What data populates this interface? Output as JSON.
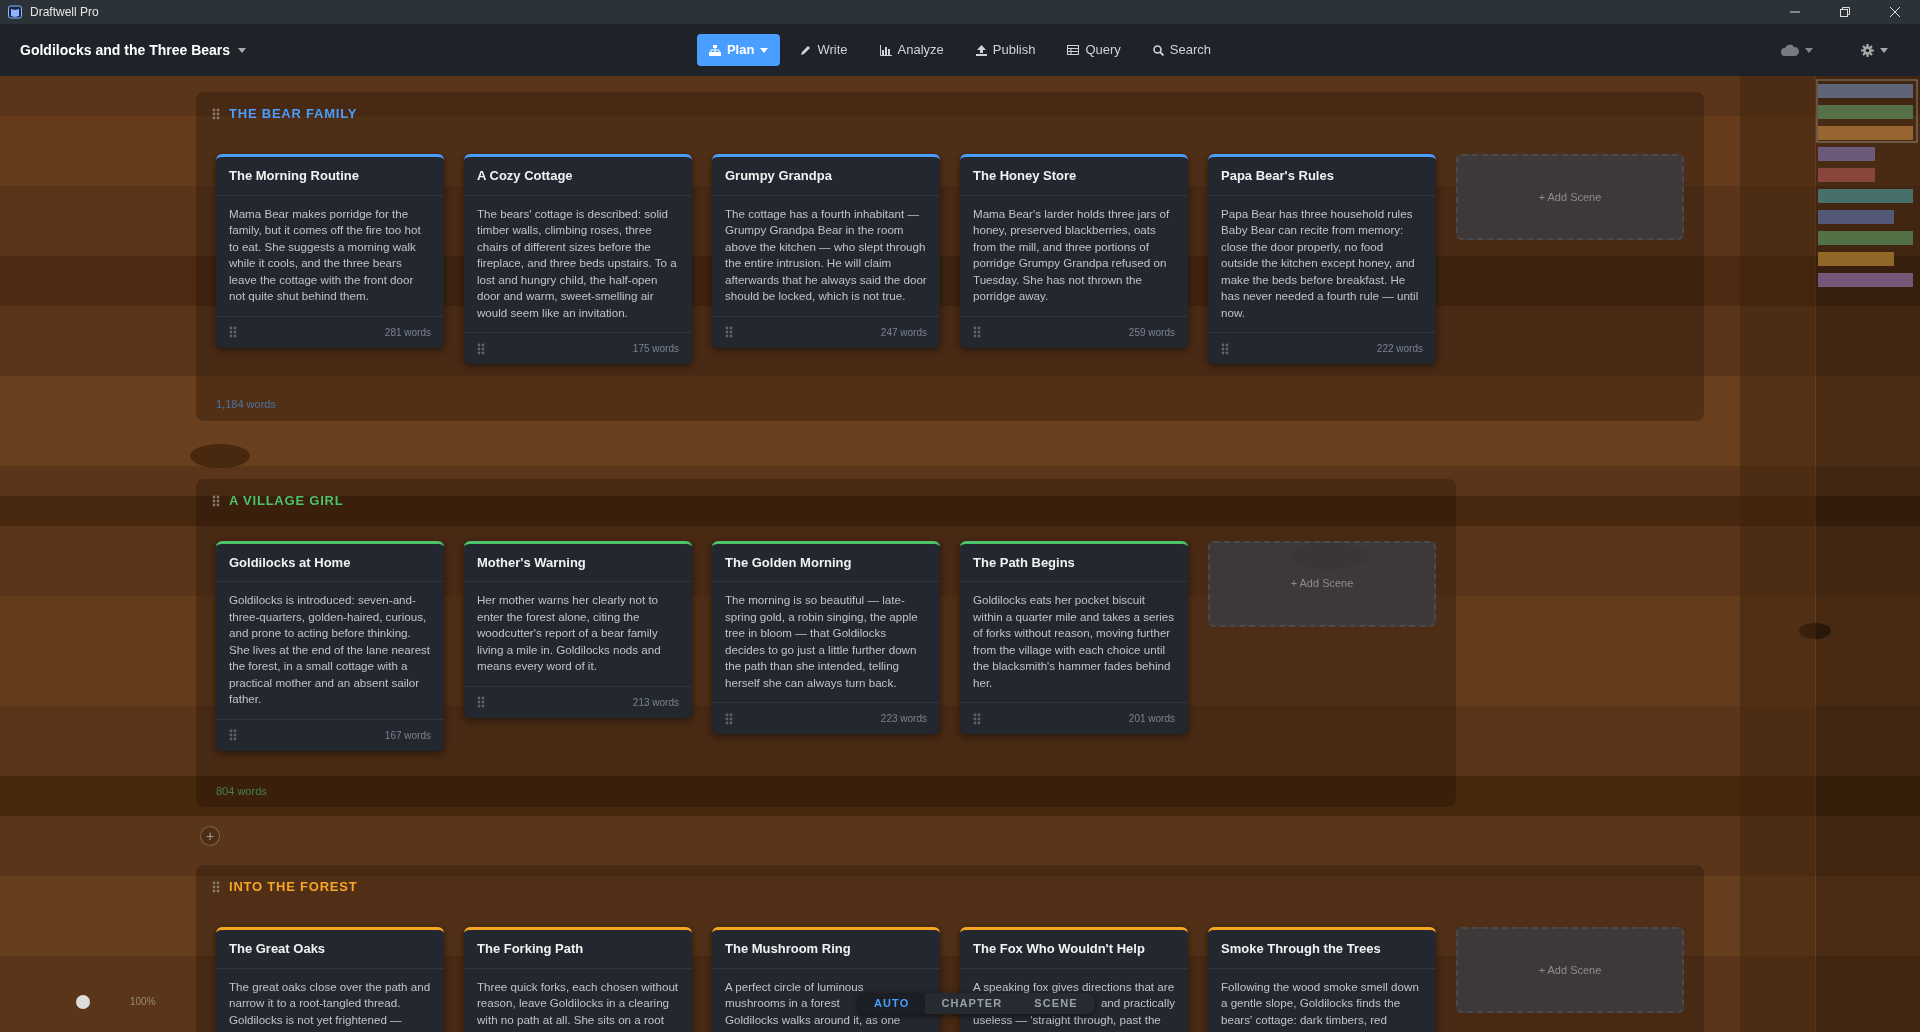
{
  "window": {
    "title": "Draftwell Pro"
  },
  "project": {
    "title": "Goldilocks and the Three Bears"
  },
  "nav": [
    {
      "label": "Plan",
      "selected": true,
      "has_menu": true
    },
    {
      "label": "Write",
      "selected": false,
      "has_menu": false
    },
    {
      "label": "Analyze",
      "selected": false,
      "has_menu": false
    },
    {
      "label": "Publish",
      "selected": false,
      "has_menu": false
    },
    {
      "label": "Query",
      "selected": false,
      "has_menu": false
    },
    {
      "label": "Search",
      "selected": false,
      "has_menu": false
    }
  ],
  "chapters": [
    {
      "title": "THE BEAR FAMILY",
      "color": "#4a9eff",
      "total": "1,184 words",
      "add_label": "+ Add Scene",
      "scenes": [
        {
          "title": "The Morning Routine",
          "body": "Mama Bear makes porridge for the family, but it comes off the fire too hot to eat. She suggests a morning walk while it cools, and the three bears leave the cottage with the front door not quite shut behind them.",
          "words": "281 words"
        },
        {
          "title": "A Cozy Cottage",
          "body": "The bears' cottage is described: solid timber walls, climbing roses, three chairs of different sizes before the fireplace, and three beds upstairs. To a lost and hungry child, the half-open door and warm, sweet-smelling air would seem like an invitation.",
          "words": "175 words"
        },
        {
          "title": "Grumpy Grandpa",
          "body": "The cottage has a fourth inhabitant — Grumpy Grandpa Bear in the room above the kitchen — who slept through the entire intrusion. He will claim afterwards that he always said the door should be locked, which is not true.",
          "words": "247 words"
        },
        {
          "title": "The Honey Store",
          "body": "Mama Bear's larder holds three jars of honey, preserved blackberries, oats from the mill, and three portions of porridge Grumpy Grandpa refused on Tuesday. She has not thrown the porridge away.",
          "words": "259 words"
        },
        {
          "title": "Papa Bear's Rules",
          "body": "Papa Bear has three household rules Baby Bear can recite from memory: close the door properly, no food outside the kitchen except honey, and make the beds before breakfast. He has never needed a fourth rule — until now.",
          "words": "222 words"
        }
      ]
    },
    {
      "title": "A VILLAGE GIRL",
      "color": "#4cc36a",
      "total": "804 words",
      "add_label": "+ Add Scene",
      "scenes": [
        {
          "title": "Goldilocks at Home",
          "body": "Goldilocks is introduced: seven-and-three-quarters, golden-haired, curious, and prone to acting before thinking. She lives at the end of the lane nearest the forest, in a small cottage with a practical mother and an absent sailor father.",
          "words": "167 words"
        },
        {
          "title": "Mother's Warning",
          "body": "Her mother warns her clearly not to enter the forest alone, citing the woodcutter's report of a bear family living a mile in. Goldilocks nods and means every word of it.",
          "words": "213 words"
        },
        {
          "title": "The Golden Morning",
          "body": "The morning is so beautiful — late-spring gold, a robin singing, the apple tree in bloom — that Goldilocks decides to go just a little further down the path than she intended, telling herself she can always turn back.",
          "words": "223 words"
        },
        {
          "title": "The Path Begins",
          "body": "Goldilocks eats her pocket biscuit within a quarter mile and takes a series of forks without reason, moving further from the village with each choice until the blacksmith's hammer fades behind her.",
          "words": "201 words"
        }
      ]
    },
    {
      "title": "INTO THE FOREST",
      "add_chapter_label": "+",
      "color": "#f5a623",
      "add_label": "+ Add Scene",
      "scenes": [
        {
          "title": "The Great Oaks",
          "body": "The great oaks close over the path and narrow it to a root-tangled thread. Goldilocks is not yet frightened —"
        },
        {
          "title": "The Forking Path",
          "body": "Three quick forks, each chosen without reason, leave Goldilocks in a clearing with no path at all. She sits on a root"
        },
        {
          "title": "The Mushroom Ring",
          "lines": [
            {
              "text": "A perfect circle of luminous",
              "covered_before": false
            },
            {
              "text": "mushrooms in a forest",
              "covered_before": false
            },
            {
              "text": "Goldilocks walks around it, as one",
              "covered_before": false
            }
          ]
        },
        {
          "title": "The Fox Who Wouldn't Help",
          "lines": [
            {
              "text": "A speaking fox gives directions that are",
              "covered_before": false
            },
            {
              "text": "and practically",
              "covered_before": true
            },
            {
              "text": "useless — 'straight through, past the",
              "covered_before": false
            }
          ]
        },
        {
          "title": "Smoke Through the Trees",
          "body": "Following the wood smoke smell down a gentle slope, Goldilocks finds the bears' cottage: dark timbers, red"
        }
      ]
    }
  ],
  "view_modes": [
    {
      "label": "AUTO",
      "selected": true
    },
    {
      "label": "CHAPTER",
      "selected": false
    },
    {
      "label": "SCENE",
      "selected": false
    }
  ],
  "zoom": {
    "reading": "100%"
  }
}
